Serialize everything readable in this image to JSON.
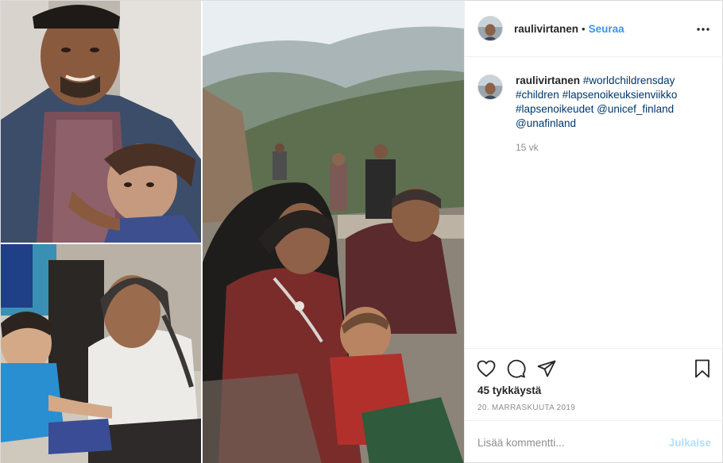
{
  "post": {
    "username": "raulivirtanen",
    "separator": "•",
    "follow_label": "Seuraa",
    "more_icon": "more-options-icon"
  },
  "caption": {
    "username": "raulivirtanen",
    "hashtags_line1": "#worldchildrensday",
    "hashtags_line2a": "#children",
    "hashtags_line2b": "#lapsenoikeuksienviikko",
    "hashtags_line3": "#lapsenoikeudet",
    "mention1": "@unicef_finland",
    "mention2": "@unafinland",
    "time": "15 vk"
  },
  "actions": {
    "icons": [
      "heart-icon",
      "comment-icon",
      "share-icon",
      "bookmark-icon"
    ],
    "likes": "45 tykkäystä",
    "date": "20. marraskuuta 2019"
  },
  "comment_box": {
    "placeholder": "Lisää kommentti...",
    "publish_label": "Julkaise"
  },
  "colors": {
    "accent": "#3897f0",
    "link": "#00376b",
    "muted": "#8e8e8e",
    "publish_disabled": "#b2dffc",
    "border": "#efefef"
  }
}
